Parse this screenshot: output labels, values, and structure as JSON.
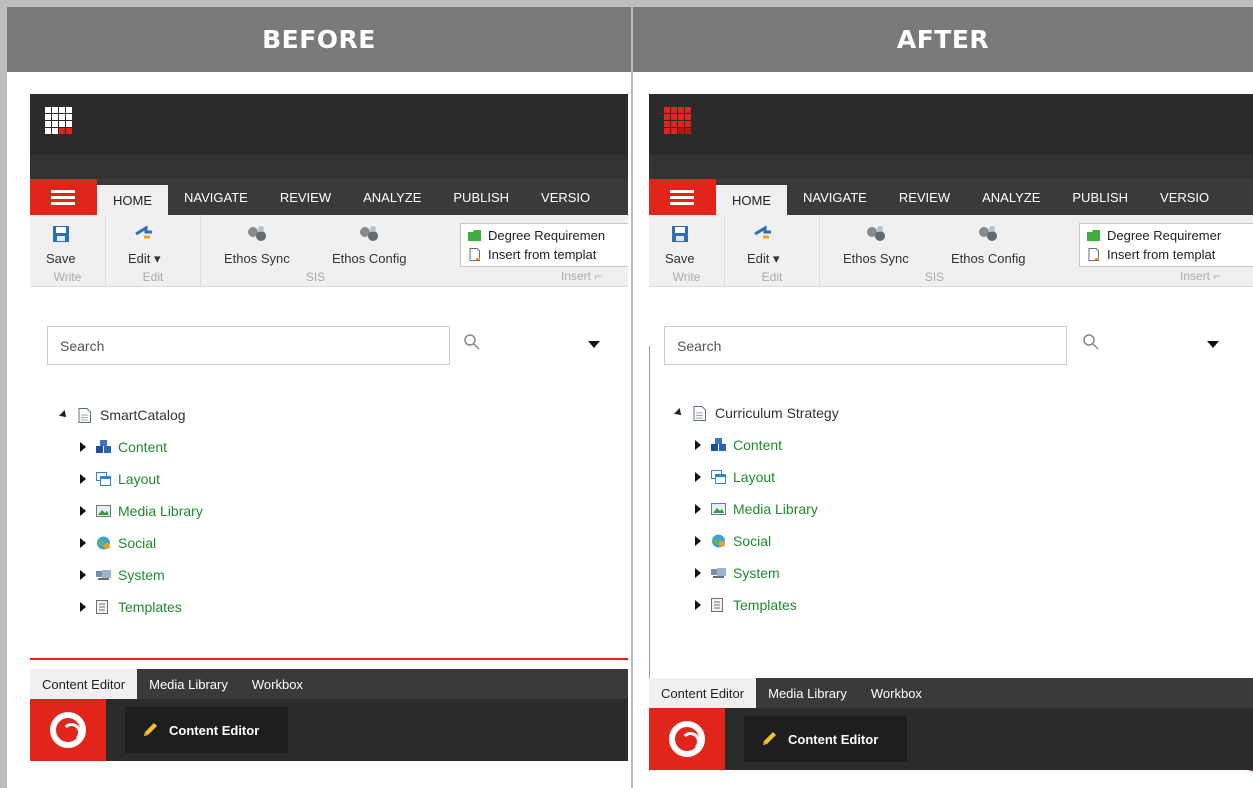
{
  "panels": [
    {
      "id": "before",
      "header": "BEFORE",
      "tabs": [
        "HOME",
        "NAVIGATE",
        "REVIEW",
        "ANALYZE",
        "PUBLISH",
        "VERSIO"
      ],
      "ribbon": {
        "save": "Save",
        "edit": "Edit",
        "ethos_sync": "Ethos Sync",
        "ethos_config": "Ethos Config",
        "groups": {
          "write": "Write",
          "edit": "Edit",
          "sis": "SIS",
          "insert": "Insert"
        },
        "insert_items": [
          "Degree Requiremen",
          "Insert from templat"
        ]
      },
      "search": {
        "placeholder": "Search"
      },
      "tree": {
        "root": "SmartCatalog",
        "children": [
          "Content",
          "Layout",
          "Media Library",
          "Social",
          "System",
          "Templates"
        ]
      },
      "bottom_tabs": [
        "Content Editor",
        "Media Library",
        "Workbox"
      ],
      "footer_button": "Content Editor"
    },
    {
      "id": "after",
      "header": "AFTER",
      "tabs": [
        "HOME",
        "NAVIGATE",
        "REVIEW",
        "ANALYZE",
        "PUBLISH",
        "VERSIO"
      ],
      "ribbon": {
        "save": "Save",
        "edit": "Edit",
        "ethos_sync": "Ethos Sync",
        "ethos_config": "Ethos Config",
        "groups": {
          "write": "Write",
          "edit": "Edit",
          "sis": "SIS",
          "insert": "Insert"
        },
        "insert_items": [
          "Degree Requiremer",
          "Insert from templat"
        ]
      },
      "search": {
        "placeholder": "Search"
      },
      "tree": {
        "root": "Curriculum Strategy",
        "children": [
          "Content",
          "Layout",
          "Media Library",
          "Social",
          "System",
          "Templates"
        ]
      },
      "bottom_tabs": [
        "Content Editor",
        "Media Library",
        "Workbox"
      ],
      "footer_button": "Content Editor"
    }
  ],
  "colors": {
    "accent": "#e1251b",
    "dark_bar": "#2b2b2b",
    "tree_link": "#1f8a2f",
    "header_bg": "#7a7a7a"
  }
}
